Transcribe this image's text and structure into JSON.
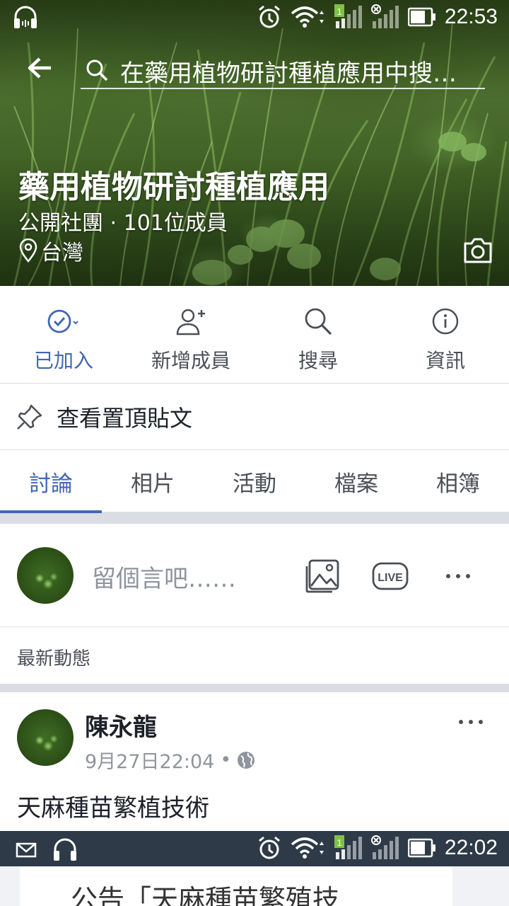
{
  "status_bar": {
    "time": "22:53",
    "icons": [
      "headset-icon",
      "alarm-icon",
      "wifi-icon",
      "signal-sim1-icon",
      "signal-sim2-icon",
      "battery-icon"
    ]
  },
  "search": {
    "placeholder": "在藥用植物研討種植應用中搜…"
  },
  "group": {
    "name": "藥用植物研討種植應用",
    "meta": "公開社團 · 101位成員",
    "location": "台灣"
  },
  "actions": [
    {
      "label": "已加入",
      "icon": "check-circle-icon",
      "active": true
    },
    {
      "label": "新增成員",
      "icon": "add-person-icon",
      "active": false
    },
    {
      "label": "搜尋",
      "icon": "search-icon",
      "active": false
    },
    {
      "label": "資訊",
      "icon": "info-icon",
      "active": false
    }
  ],
  "pinned": {
    "label": "查看置頂貼文"
  },
  "tabs": [
    {
      "label": "討論",
      "active": true
    },
    {
      "label": "相片",
      "active": false
    },
    {
      "label": "活動",
      "active": false
    },
    {
      "label": "檔案",
      "active": false
    },
    {
      "label": "相簿",
      "active": false
    }
  ],
  "composer": {
    "placeholder": "留個言吧……"
  },
  "feed": {
    "header": "最新動態"
  },
  "post": {
    "author": "陳永龍",
    "timestamp": "9月27日22:04",
    "visibility_icon": "globe-icon",
    "text": "天麻種苗繁植技術"
  },
  "embedded_screenshot": {
    "time": "22:02",
    "text": "公告「天麻種苗繁殖技"
  },
  "colors": {
    "accent": "#4267b2",
    "text": "#1d2129",
    "secondary": "#90949c",
    "divider": "#dadde1"
  }
}
